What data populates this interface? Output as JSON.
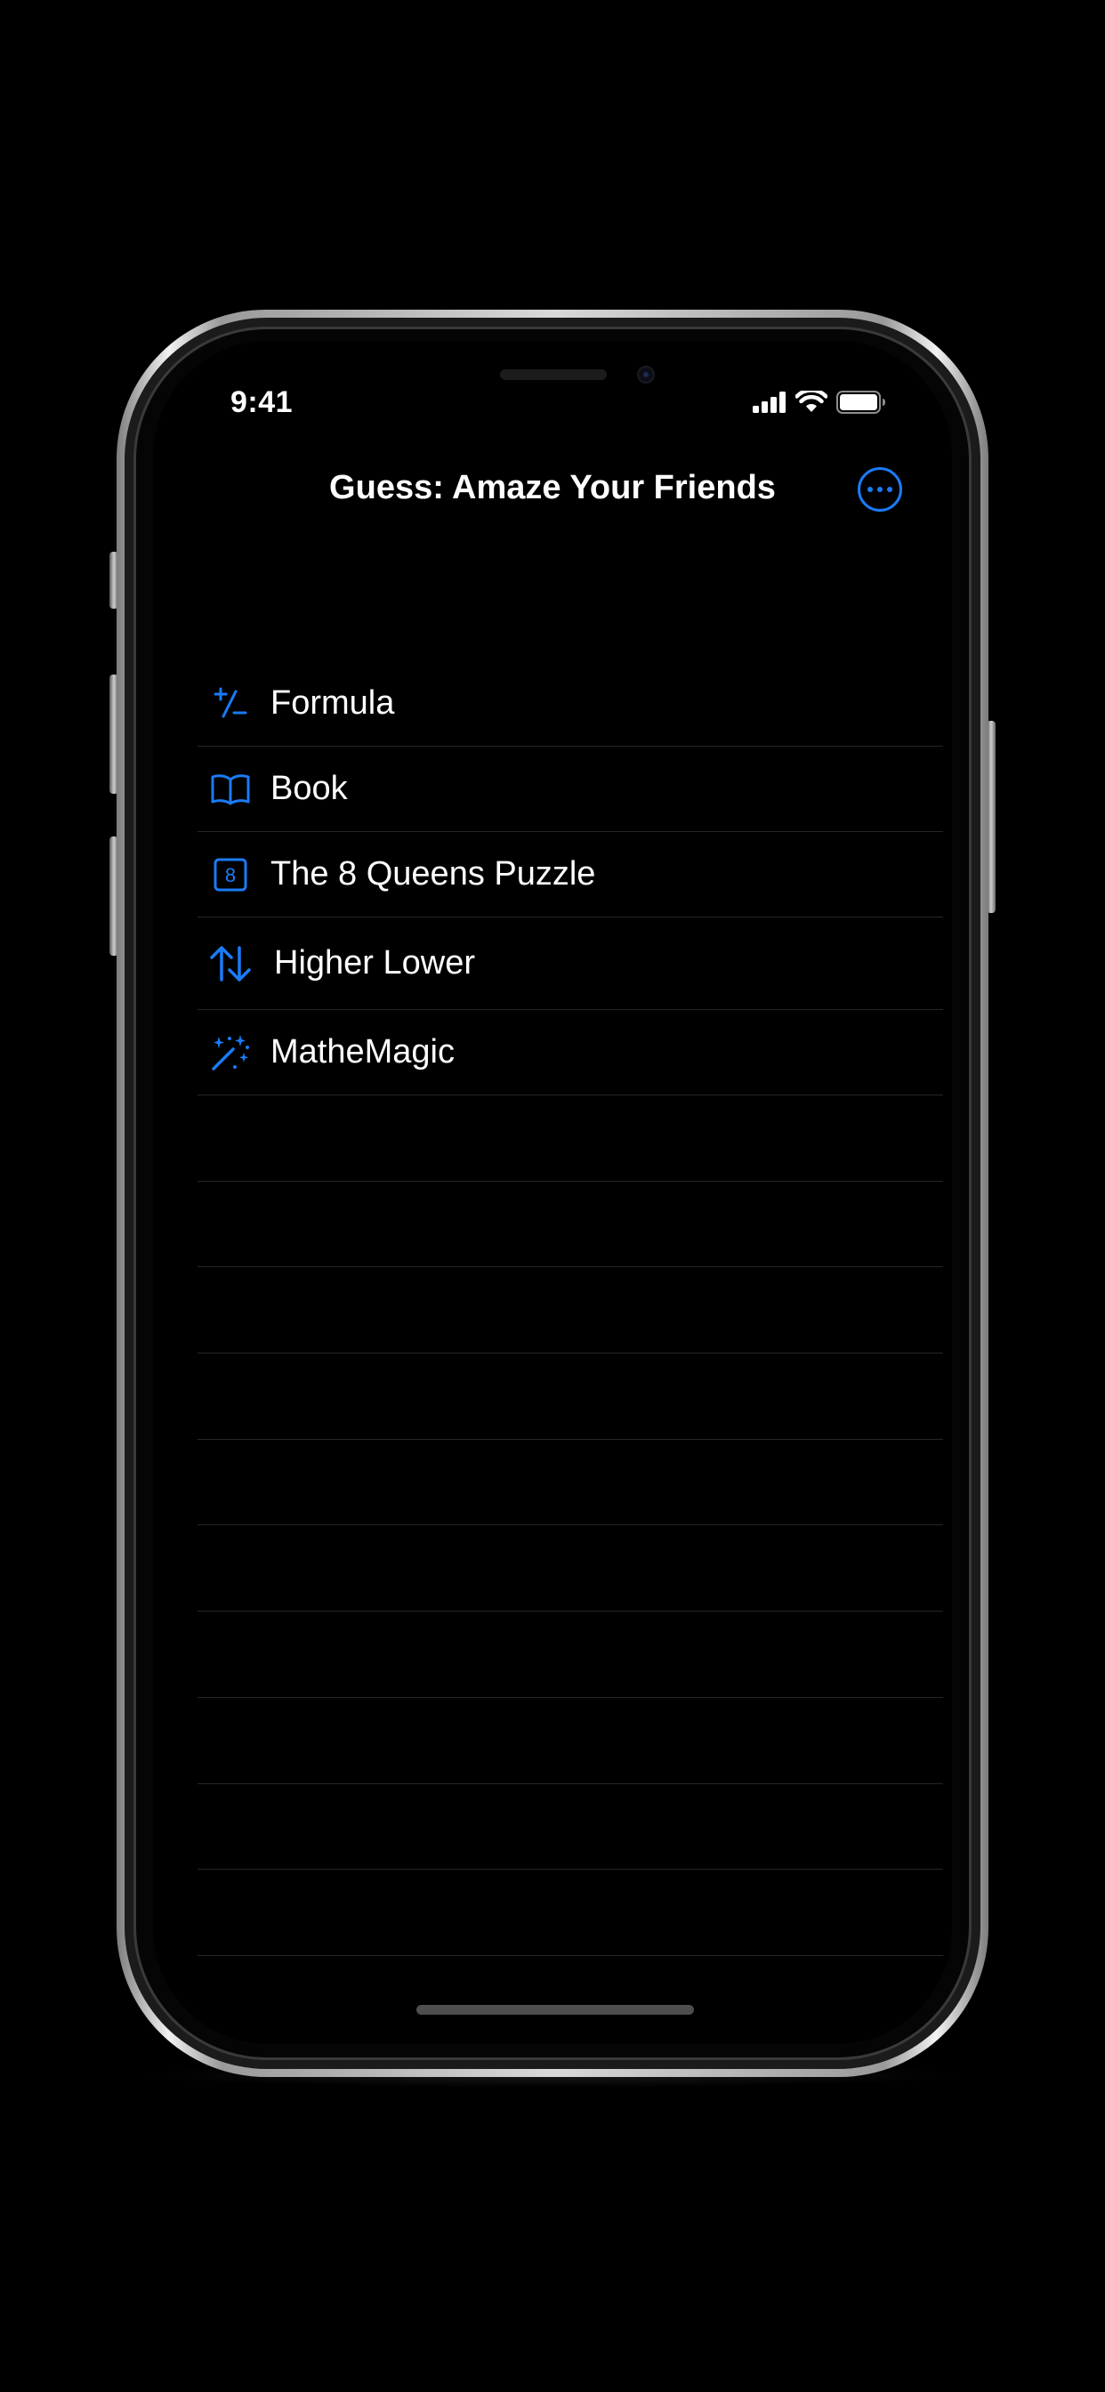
{
  "status_bar": {
    "time": "9:41",
    "signal_icon": "cellular-signal-icon",
    "wifi_icon": "wifi-icon",
    "battery_icon": "battery-icon"
  },
  "nav": {
    "title": "Guess: Amaze Your Friends",
    "more_icon": "ellipsis-circle-icon"
  },
  "accent_color": "#1a7cf7",
  "menu": {
    "items": [
      {
        "label": "Formula",
        "icon": "plus-minus-icon"
      },
      {
        "label": "Book",
        "icon": "book-icon"
      },
      {
        "label": "The 8 Queens Puzzle",
        "icon": "number-8-square-icon"
      },
      {
        "label": "Higher Lower",
        "icon": "arrow-up-down-icon"
      },
      {
        "label": "MatheMagic",
        "icon": "magic-wand-icon"
      }
    ]
  },
  "queens_icon_text": "8"
}
